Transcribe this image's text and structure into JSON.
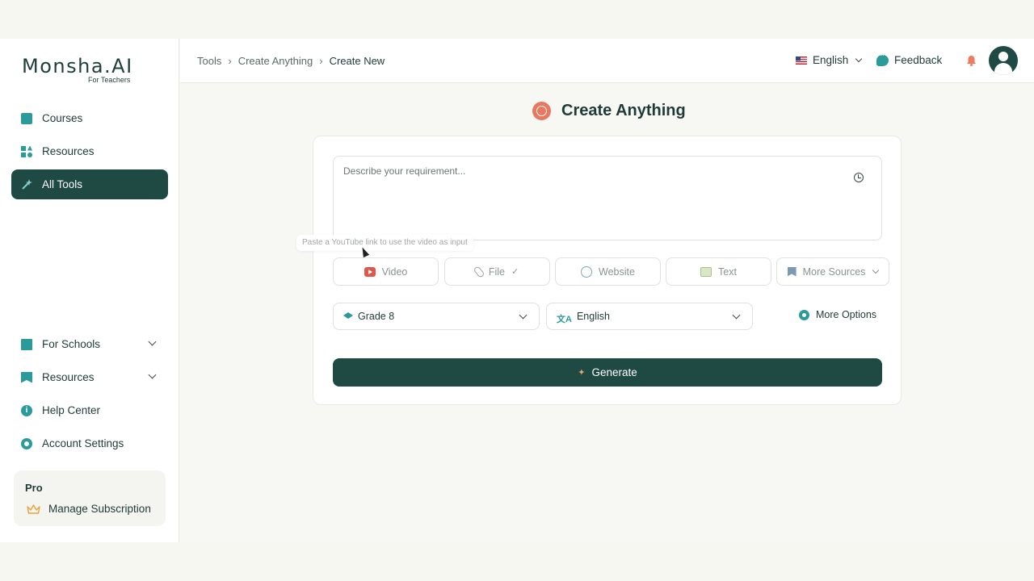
{
  "brand": {
    "name": "Monsha.AI",
    "tagline": "For Teachers"
  },
  "sidebar": {
    "top_items": [
      {
        "label": "Courses",
        "icon": "book-icon"
      },
      {
        "label": "Resources",
        "icon": "shapes-icon"
      },
      {
        "label": "All Tools",
        "icon": "magic-wand-icon",
        "active": true
      }
    ],
    "bottom_items": [
      {
        "label": "For Schools",
        "icon": "building-icon"
      },
      {
        "label": "Resources",
        "icon": "bookmark-icon"
      },
      {
        "label": "Help Center",
        "icon": "info-icon"
      },
      {
        "label": "Account Settings",
        "icon": "gear-icon"
      }
    ],
    "plan": {
      "label": "Pro",
      "manage_label": "Manage Subscription"
    }
  },
  "header": {
    "breadcrumb": [
      "Tools",
      "Create Anything",
      "Create New"
    ],
    "language": "English",
    "feedback_label": "Feedback"
  },
  "main": {
    "title": "Create Anything",
    "prompt": {
      "placeholder": "Describe your requirement...",
      "value": ""
    },
    "tooltip": "Paste a YouTube link to use the video as input",
    "sources": [
      {
        "label": "Video",
        "icon": "youtube-icon"
      },
      {
        "label": "File",
        "icon": "paperclip-icon",
        "check": "✓"
      },
      {
        "label": "Website",
        "icon": "globe-icon"
      },
      {
        "label": "Text",
        "icon": "text-doc-icon"
      },
      {
        "label": "More Sources",
        "icon": "bookmark-icon"
      }
    ],
    "grade": "Grade 8",
    "output_language": "English",
    "more_options_label": "More Options",
    "generate_label": "Generate"
  },
  "colors": {
    "primary": "#1f4a44",
    "accent": "#2a9a9a",
    "brand_orange": "#e8785f"
  }
}
